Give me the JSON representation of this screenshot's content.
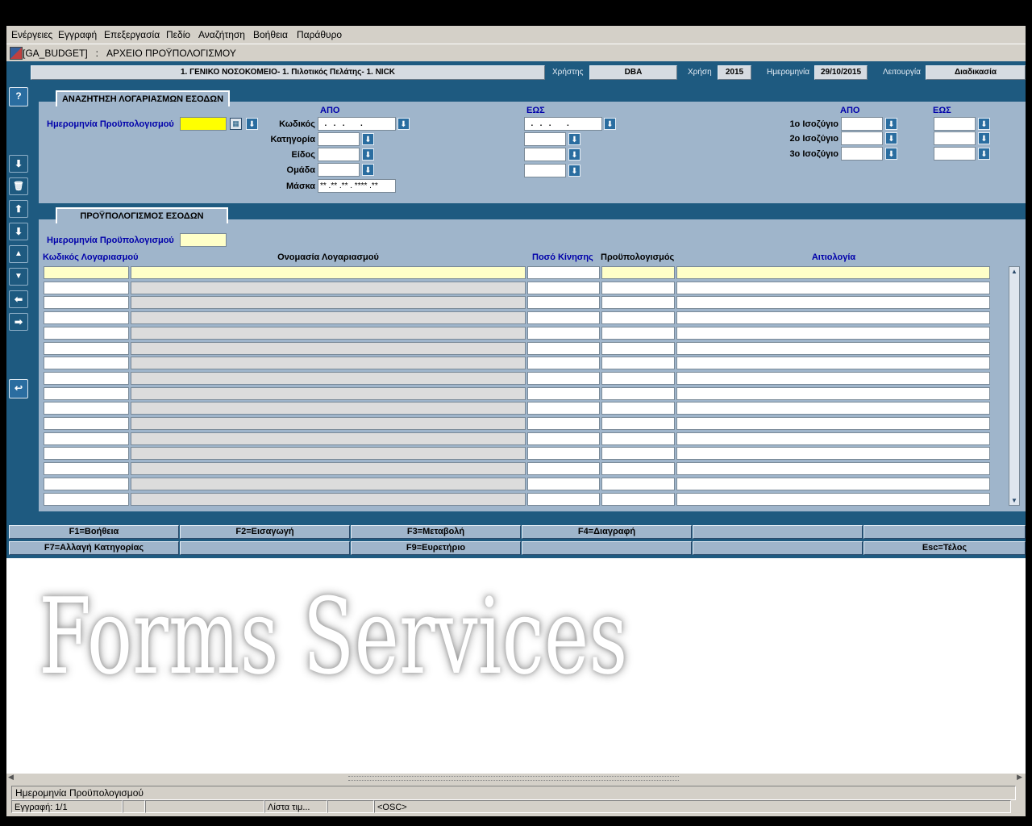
{
  "menu": [
    "Ενέργειες",
    "Εγγραφή",
    "Επεξεργασία",
    "Πεδίο",
    "Αναζήτηση",
    "Βοήθεια",
    "Παράθυρο"
  ],
  "window": {
    "title": "[GA_BUDGET]   :   ΑΡΧΕΙΟ ΠΡΟΫΠΟΛΟΓΙΣΜΟΥ"
  },
  "header": {
    "organization": "1. ΓΕΝΙΚΟ ΝΟΣΟΚΟΜΕΙΟ- 1. Πιλοτικός Πελάτης- 1. NICK",
    "user_label": "Χρήστης",
    "user": "DBA",
    "year_label": "Χρήση",
    "year": "2015",
    "date_label": "Ημερομηνία",
    "date": "29/10/2015",
    "mode_label": "Λειτουργία",
    "mode": "Διαδικασία"
  },
  "toolbar": {
    "help": "?",
    "down_arrow": "⬇",
    "trash": "🗑",
    "up": "⬆",
    "down": "⬇",
    "prev": "▲",
    "next": "▼",
    "left": "⬅",
    "right": "➡",
    "undo": "↩"
  },
  "search": {
    "tab_label": "ΑΝΑΖΗΤΗΣΗ ΛΟΓΑΡΙΑΣΜΩΝ ΕΣΟΔΩΝ",
    "from_label": "ΑΠΟ",
    "to_label": "ΕΩΣ",
    "budget_date_label": "Ημερομηνία Προϋπολογισμού",
    "budget_date_value": "",
    "code_label": "Κωδικός",
    "code_from": "  .   .   .       .",
    "code_to": "  .   .   .       .",
    "category_label": "Κατηγορία",
    "type_label": "Είδος",
    "group_label": "Ομάδα",
    "mask_label": "Μάσκα",
    "mask_value": "** .** .** . **** .**",
    "balance_from_label": "ΑΠΟ",
    "balance_to_label": "ΕΩΣ",
    "balances": [
      "1ο Ισοζύγιο",
      "2ο Ισοζύγιο",
      "3ο Ισοζύγιο"
    ]
  },
  "budget": {
    "tab_label": "ΠΡΟΫΠΟΛΟΓΙΣΜΟΣ ΕΣΟΔΩΝ",
    "date_label": "Ημερομηνία Προϋπολογισμού",
    "date_value": "",
    "columns": [
      "Κωδικός Λογαριασμού",
      "Ονομασία Λογαριασμού",
      "Ποσό Κίνησης",
      "Προϋπολογισμός",
      "Αιτιολογία"
    ],
    "row_count": 16
  },
  "fkeys": {
    "row1": [
      "F1=Βοήθεια",
      "F2=Εισαγωγή",
      "F3=Μεταβολή",
      "F4=Διαγραφή",
      "",
      ""
    ],
    "row2": [
      "F7=Αλλαγή Κατηγορίας",
      "",
      "F9=Ευρετήριο",
      "",
      "",
      "Esc=Τέλος"
    ]
  },
  "watermark": {
    "line2": "Forms Services"
  },
  "status": {
    "hint": "Ημερομηνία Προϋπολογισμού",
    "record": "Εγγραφή: 1/1",
    "lov": "Λίστα τιμ...",
    "osc": "<OSC>"
  },
  "colors": {
    "background": "#1e5a80",
    "panel": "#9fb5cb",
    "current_field": "#ffff00",
    "current_record": "#ffffc8"
  }
}
